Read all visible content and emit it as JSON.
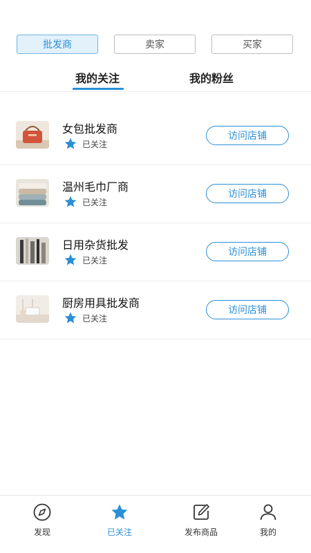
{
  "top_tabs": [
    "批发商",
    "卖家",
    "买家"
  ],
  "sub_tabs": [
    "我的关注",
    "我的粉丝"
  ],
  "followed_label": "已关注",
  "visit_label": "访问店铺",
  "shops": [
    {
      "name": "女包批发商",
      "image": "handbag"
    },
    {
      "name": "温州毛巾厂商",
      "image": "towels"
    },
    {
      "name": "日用杂货批发",
      "image": "brushes"
    },
    {
      "name": "厨房用具批发商",
      "image": "kitchenware"
    }
  ],
  "bottom_nav": [
    {
      "label": "发现",
      "icon": "compass-icon"
    },
    {
      "label": "已关注",
      "icon": "star-icon"
    },
    {
      "label": "发布商品",
      "icon": "edit-icon"
    },
    {
      "label": "我的",
      "icon": "user-icon"
    }
  ],
  "colors": {
    "accent": "#2a8fd6",
    "active_tab_bg": "#e3f1fb"
  }
}
